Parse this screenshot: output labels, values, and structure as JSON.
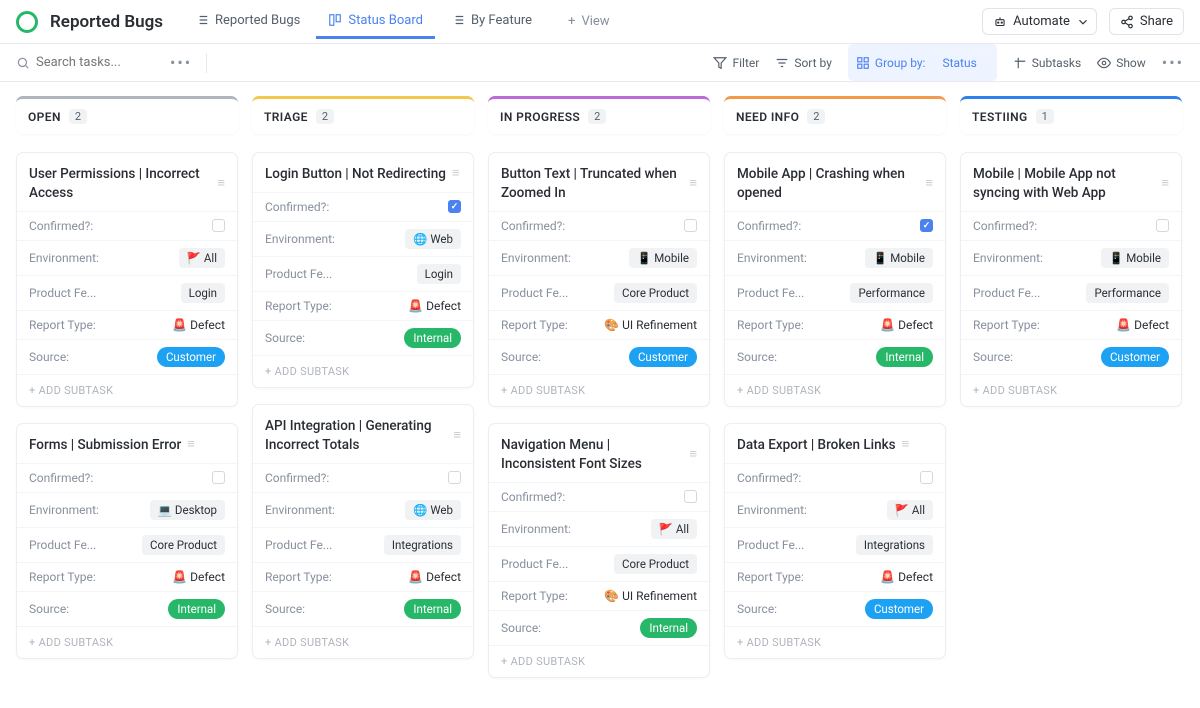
{
  "header": {
    "title": "Reported Bugs",
    "views": [
      {
        "label": "Reported Bugs",
        "active": false
      },
      {
        "label": "Status Board",
        "active": true
      },
      {
        "label": "By Feature",
        "active": false
      }
    ],
    "addView": "View",
    "automate": "Automate",
    "share": "Share"
  },
  "toolbar": {
    "searchPlaceholder": "Search tasks...",
    "filter": "Filter",
    "sortBy": "Sort by",
    "groupByLabel": "Group by:",
    "groupByField": "Status",
    "subtasks": "Subtasks",
    "show": "Show"
  },
  "fieldLabels": {
    "confirmed": "Confirmed?:",
    "environment": "Environment:",
    "productFeature": "Product Fe...",
    "reportType": "Report Type:",
    "source": "Source:",
    "addSubtask": "+ ADD SUBTASK"
  },
  "environments": {
    "all": "All",
    "web": "Web",
    "desktop": "Desktop",
    "mobile": "Mobile"
  },
  "features": {
    "login": "Login",
    "coreProduct": "Core Product",
    "integrations": "Integrations",
    "performance": "Performance"
  },
  "reportTypes": {
    "defect": "Defect",
    "uiRefinement": "UI Refinement"
  },
  "sources": {
    "customer": "Customer",
    "internal": "Internal"
  },
  "columns": [
    {
      "name": "OPEN",
      "count": "2",
      "color": "#b0b5bd",
      "cards": [
        {
          "title": "User Permissions | Incorrect Access",
          "confirmed": false,
          "environment": "all",
          "feature": "login",
          "reportType": "defect",
          "source": "customer"
        },
        {
          "title": "Forms | Submission Error",
          "confirmed": false,
          "environment": "desktop",
          "feature": "coreProduct",
          "reportType": "defect",
          "source": "internal"
        }
      ]
    },
    {
      "name": "TRIAGE",
      "count": "2",
      "color": "#f2c94c",
      "cards": [
        {
          "title": "Login Button | Not Redirecting",
          "confirmed": true,
          "environment": "web",
          "feature": "login",
          "reportType": "defect",
          "source": "internal"
        },
        {
          "title": "API Integration | Generating Incorrect Totals",
          "confirmed": false,
          "environment": "web",
          "feature": "integrations",
          "reportType": "defect",
          "source": "internal"
        }
      ]
    },
    {
      "name": "IN PROGRESS",
      "count": "2",
      "color": "#bb6bd9",
      "cards": [
        {
          "title": "Button Text | Truncated when Zoomed In",
          "confirmed": false,
          "environment": "mobile",
          "feature": "coreProduct",
          "reportType": "uiRefinement",
          "source": "customer"
        },
        {
          "title": "Navigation Menu | Inconsistent Font Sizes",
          "confirmed": false,
          "environment": "all",
          "feature": "coreProduct",
          "reportType": "uiRefinement",
          "source": "internal"
        }
      ]
    },
    {
      "name": "NEED INFO",
      "count": "2",
      "color": "#f2994a",
      "cards": [
        {
          "title": "Mobile App | Crashing when opened",
          "confirmed": true,
          "environment": "mobile",
          "feature": "performance",
          "reportType": "defect",
          "source": "internal"
        },
        {
          "title": "Data Export | Broken Links",
          "confirmed": false,
          "environment": "all",
          "feature": "integrations",
          "reportType": "defect",
          "source": "customer"
        }
      ]
    },
    {
      "name": "TESTIING",
      "count": "1",
      "color": "#2f80ed",
      "cards": [
        {
          "title": "Mobile | Mobile App not syncing with Web App",
          "confirmed": false,
          "environment": "mobile",
          "feature": "performance",
          "reportType": "defect",
          "source": "customer"
        }
      ]
    }
  ]
}
